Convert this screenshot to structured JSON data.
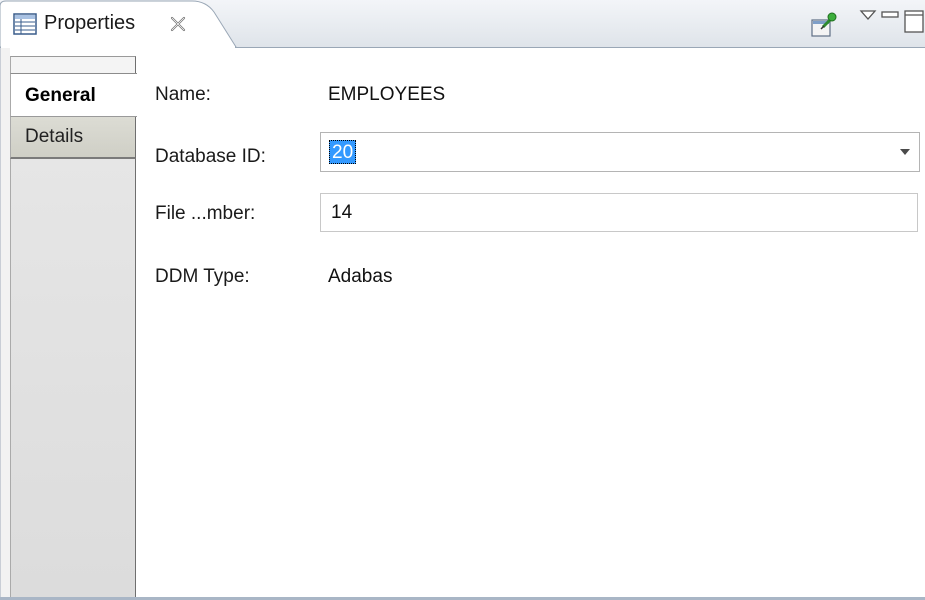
{
  "view": {
    "title": "Properties",
    "icons": {
      "title": "properties-table-icon",
      "close": "close-x-icon",
      "pin": "pin-to-selection-icon",
      "menu": "view-menu-triangle-icon",
      "minimize": "minimize-icon",
      "maximize": "maximize-icon"
    }
  },
  "section_tabs": [
    {
      "label": "General",
      "active": true
    },
    {
      "label": "Details",
      "active": false
    }
  ],
  "form": {
    "name": {
      "label": "Name:",
      "value": "EMPLOYEES"
    },
    "database_id": {
      "label": "Database ID:",
      "value": "20",
      "selected": true
    },
    "file_number": {
      "label": "File ...mber:",
      "value": "14"
    },
    "ddm_type": {
      "label": "DDM Type:",
      "value": "Adabas"
    }
  },
  "colors": {
    "selection": "#3399ff",
    "header_gradient_top": "#f3f5f8",
    "header_gradient_bottom": "#dfe4ea",
    "frame_border": "#a9b6c6"
  }
}
